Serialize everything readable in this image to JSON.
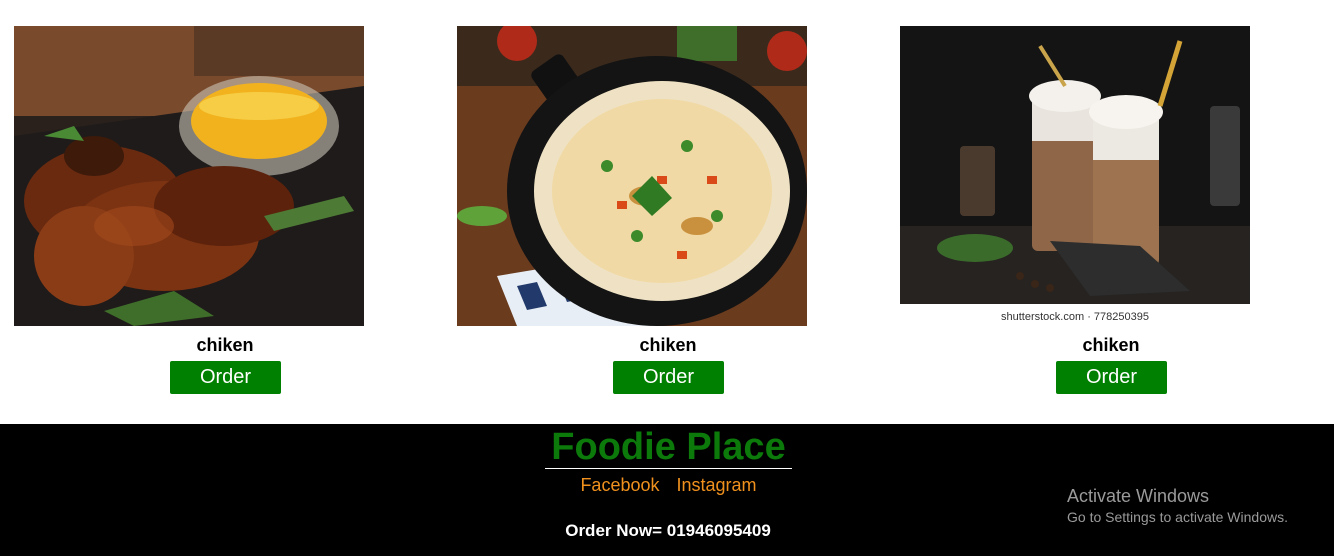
{
  "products": [
    {
      "name": "chiken",
      "button": "Order",
      "image": "grilled-chicken-photo"
    },
    {
      "name": "chiken",
      "button": "Order",
      "image": "fried-rice-photo"
    },
    {
      "name": "chiken",
      "button": "Order",
      "image": "iced-coffee-photo",
      "image_caption": "shutterstock.com · 778250395"
    }
  ],
  "footer": {
    "brand": "Foodie Place",
    "links": [
      "Facebook",
      "Instagram"
    ],
    "order_now": "Order Now= 01946095409"
  },
  "watermark": {
    "title": "Activate Windows",
    "subtitle": "Go to Settings to activate Windows."
  },
  "colors": {
    "order_button": "#008000",
    "brand": "#0b7a0b",
    "links": "#f0911e",
    "footer_bg": "#000000"
  }
}
